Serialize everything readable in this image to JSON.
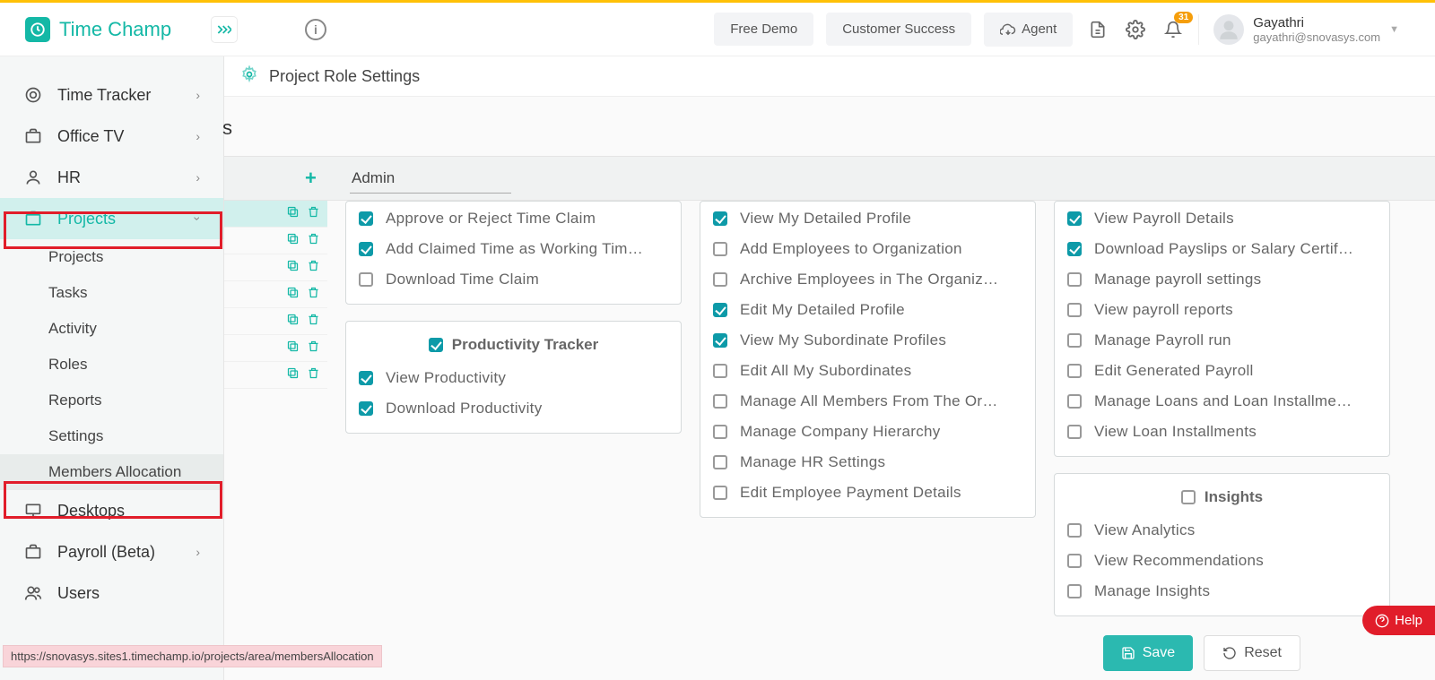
{
  "brand": "Time Champ",
  "header": {
    "free_demo": "Free Demo",
    "customer_success": "Customer Success",
    "agent": "Agent",
    "notif_count": "31",
    "user_name": "Gayathri",
    "user_email": "gayathri@snovasys.com"
  },
  "sidebar": {
    "items": [
      {
        "label": "Time Tracker",
        "expandable": true
      },
      {
        "label": "Office TV",
        "expandable": true
      },
      {
        "label": "HR",
        "expandable": true
      },
      {
        "label": "Projects",
        "expandable": true,
        "active": true
      },
      {
        "label": "Desktops",
        "expandable": false
      },
      {
        "label": "Payroll (Beta)",
        "expandable": true
      },
      {
        "label": "Users",
        "expandable": false
      }
    ],
    "projects_children": [
      "Projects",
      "Tasks",
      "Activity",
      "Roles",
      "Reports",
      "Settings",
      "Members Allocation"
    ]
  },
  "page_title": "Project Role Settings",
  "stray_partial_text": "s",
  "role_input_value": "Admin",
  "permissions": {
    "time_claim": [
      {
        "label": "Approve or Reject Time Claim",
        "checked": true
      },
      {
        "label": "Add Claimed Time as Working Tim…",
        "checked": true
      },
      {
        "label": "Download Time Claim",
        "checked": false
      }
    ],
    "productivity_title": "Productivity Tracker",
    "productivity": [
      {
        "label": "View Productivity",
        "checked": true
      },
      {
        "label": "Download Productivity",
        "checked": true
      }
    ],
    "profile": [
      {
        "label": "View My Detailed Profile",
        "checked": true
      },
      {
        "label": "Add Employees to Organization",
        "checked": false
      },
      {
        "label": "Archive Employees in The Organiz…",
        "checked": false
      },
      {
        "label": "Edit My Detailed Profile",
        "checked": true
      },
      {
        "label": "View My Subordinate Profiles",
        "checked": true
      },
      {
        "label": "Edit All My Subordinates",
        "checked": false
      },
      {
        "label": "Manage All Members From The Or…",
        "checked": false
      },
      {
        "label": "Manage Company Hierarchy",
        "checked": false
      },
      {
        "label": "Manage HR Settings",
        "checked": false
      },
      {
        "label": "Edit Employee Payment Details",
        "checked": false
      }
    ],
    "payroll": [
      {
        "label": "View Payroll Details",
        "checked": true
      },
      {
        "label": "Download Payslips or Salary Certif…",
        "checked": true
      },
      {
        "label": "Manage payroll settings",
        "checked": false
      },
      {
        "label": "View payroll reports",
        "checked": false
      },
      {
        "label": "Manage Payroll run",
        "checked": false
      },
      {
        "label": "Edit Generated Payroll",
        "checked": false
      },
      {
        "label": "Manage Loans and Loan Installme…",
        "checked": false
      },
      {
        "label": "View Loan Installments",
        "checked": false
      }
    ],
    "insights_title": "Insights",
    "insights": [
      {
        "label": "View Analytics",
        "checked": false
      },
      {
        "label": "View Recommendations",
        "checked": false
      },
      {
        "label": "Manage Insights",
        "checked": false
      }
    ]
  },
  "buttons": {
    "save": "Save",
    "reset": "Reset",
    "help": "Help"
  },
  "status_url": "https://snovasys.sites1.timechamp.io/projects/area/membersAllocation"
}
